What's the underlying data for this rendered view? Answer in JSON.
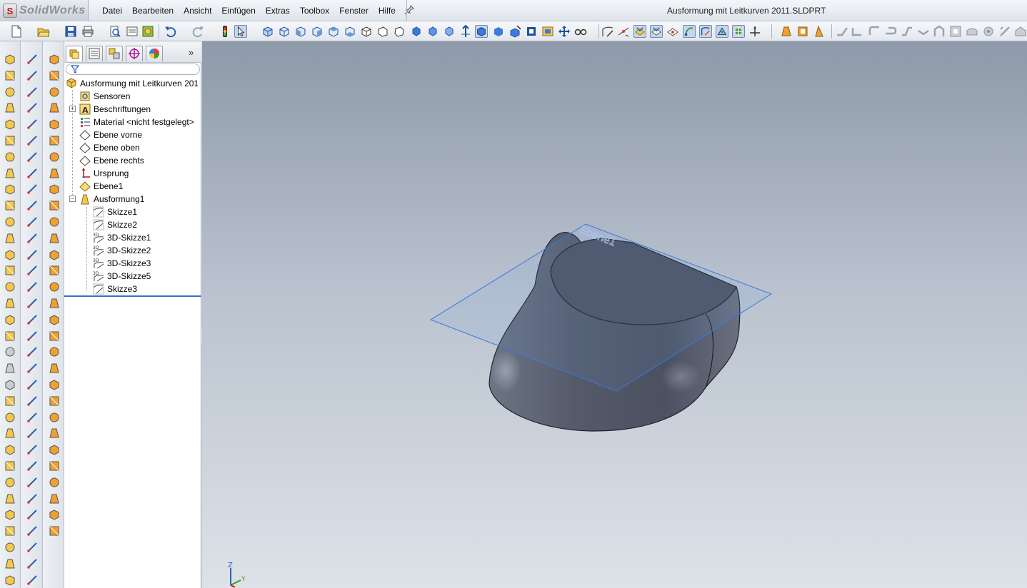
{
  "app": {
    "logo_letter": "S",
    "logo_text": "SolidWorks",
    "document_title": "Ausformung mit Leitkurven 2011.SLDPRT"
  },
  "menu": {
    "items": [
      "Datei",
      "Bearbeiten",
      "Ansicht",
      "Einfügen",
      "Extras",
      "Toolbox",
      "Fenster",
      "Hilfe"
    ]
  },
  "panel": {
    "more_label": "»",
    "tree": {
      "root": "Ausformung mit Leitkurven 201",
      "items": [
        "Sensoren",
        "Beschriftungen",
        "Material <nicht festgelegt>",
        "Ebene vorne",
        "Ebene oben",
        "Ebene rechts",
        "Ursprung",
        "Ebene1",
        "Ausformung1"
      ],
      "children": [
        "Skizze1",
        "Skizze2",
        "3D-Skizze1",
        "3D-Skizze2",
        "3D-Skizze3",
        "3D-Skizze5",
        "Skizze3"
      ]
    }
  },
  "viewport": {
    "plane_label": "Ebene1",
    "triad_z": "Z",
    "triad_y": "Y"
  },
  "colors": {
    "accent": "#3a6ec8",
    "plane": "#4a86e8",
    "body": "#5a6070"
  }
}
